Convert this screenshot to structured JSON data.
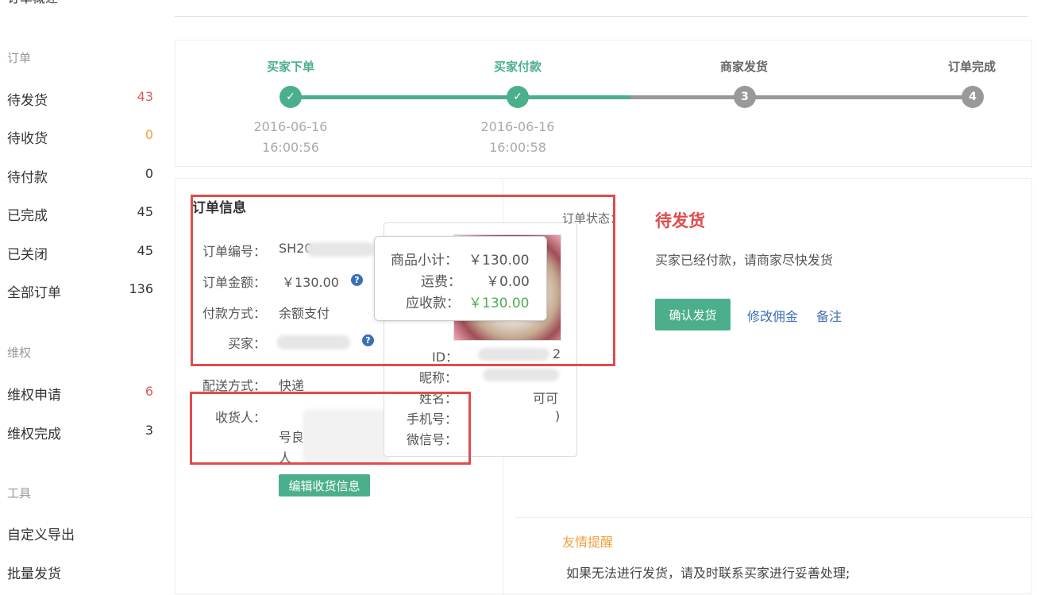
{
  "sidebar": {
    "top_cut": "订单概述",
    "groups": {
      "orders": "订单",
      "rights": "维权",
      "tools": "工具"
    },
    "items": [
      {
        "label": "待发货",
        "count": "43",
        "color": "#e05a5a"
      },
      {
        "label": "待收货",
        "count": "0",
        "color": "#f0a040"
      },
      {
        "label": "待付款",
        "count": "0",
        "color": "#333333"
      },
      {
        "label": "已完成",
        "count": "45",
        "color": "#333333"
      },
      {
        "label": "已关闭",
        "count": "45",
        "color": "#333333"
      },
      {
        "label": "全部订单",
        "count": "136",
        "color": "#333333"
      }
    ],
    "rights_items": [
      {
        "label": "维权申请",
        "count": "6",
        "color": "#e05a5a"
      },
      {
        "label": "维权完成",
        "count": "3",
        "color": "#333333"
      }
    ],
    "tool_items": [
      {
        "label": "自定义导出"
      },
      {
        "label": "批量发货"
      }
    ]
  },
  "steps": [
    {
      "label": "买家下单",
      "date": "2016-06-16",
      "time": "16:00:56",
      "done": true,
      "num": "✓"
    },
    {
      "label": "买家付款",
      "date": "2016-06-16",
      "time": "16:00:58",
      "done": true,
      "num": "✓"
    },
    {
      "label": "商家发货",
      "date": "",
      "time": "",
      "done": false,
      "num": "3"
    },
    {
      "label": "订单完成",
      "date": "",
      "time": "",
      "done": false,
      "num": "4"
    }
  ],
  "colors": {
    "accent": "#4caf8b",
    "inactive": "#999999",
    "red": "#e04c4c",
    "link": "#3d6fb4"
  },
  "order_info": {
    "title": "订单信息",
    "order_no_label": "订单编号：",
    "order_no_value": "SH20",
    "amount_label": "订单金额：",
    "amount_value": "￥130.00",
    "pay_label": "付款方式：",
    "pay_value": "余额支付",
    "buyer_label": "买家：",
    "ship_label": "配送方式：",
    "ship_value": "快递",
    "receiver_label": "收货人：",
    "receiver_line2": "号良辰",
    "receiver_line3": "人",
    "edit_btn": "编辑收货信息"
  },
  "tooltip": {
    "subtotal_label": "商品小计：",
    "subtotal_value": "￥130.00",
    "freight_label": "运费：",
    "freight_value": "￥0.00",
    "receivable_label": "应收款：",
    "receivable_value": "￥130.00"
  },
  "popover": {
    "id_label": "ID：",
    "id_value": "2",
    "nickname_label": "昵称：",
    "name_label": "姓名：",
    "name_value": "可可",
    "phone_label": "手机号：",
    "phone_value": ")",
    "wechat_label": "微信号："
  },
  "status": {
    "label": "订单状态：",
    "value": "待发货",
    "desc": "买家已经付款，请商家尽快发货",
    "confirm_btn": "确认发货",
    "modify_link": "修改佣金",
    "note_link": "备注"
  },
  "reminder": {
    "title": "友情提醒",
    "text": "如果无法进行发货，请及时联系买家进行妥善处理;"
  }
}
